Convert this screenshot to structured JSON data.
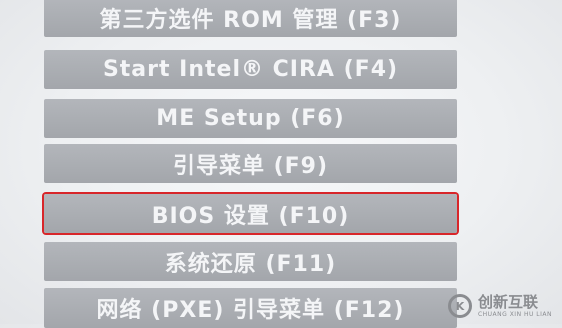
{
  "menu": {
    "items": [
      {
        "label": "第三方选件 ROM 管理 (F3)"
      },
      {
        "label": "Start Intel® CIRA (F4)"
      },
      {
        "label": "ME Setup (F6)"
      },
      {
        "label": "引导菜单 (F9)"
      },
      {
        "label": "BIOS 设置 (F10)",
        "selected": true
      },
      {
        "label": "系统还原 (F11)"
      },
      {
        "label": "网络 (PXE) 引导菜单 (F12)"
      }
    ]
  },
  "watermark": {
    "name": "创新互联",
    "subtitle": "CHUANG XIN HU LIAN"
  },
  "colors": {
    "button": "#a9acb1",
    "button_text": "#f4f5f7",
    "selection_border": "#d8262a",
    "background": "#eef0f2"
  }
}
